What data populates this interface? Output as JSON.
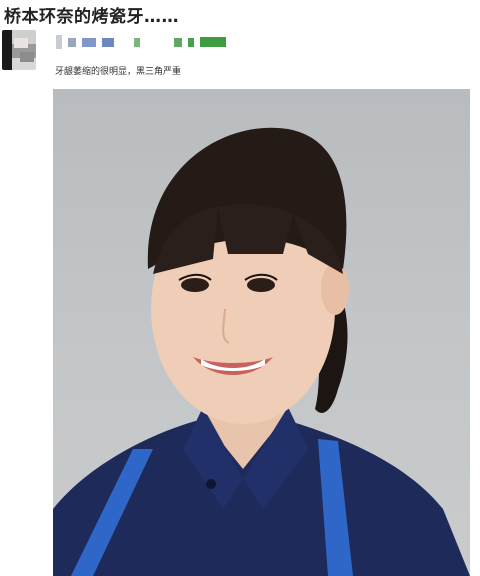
{
  "headline": "桥本环奈的烤瓷牙……",
  "post": {
    "caption": "牙龈萎缩的很明显，黑三角严重"
  }
}
